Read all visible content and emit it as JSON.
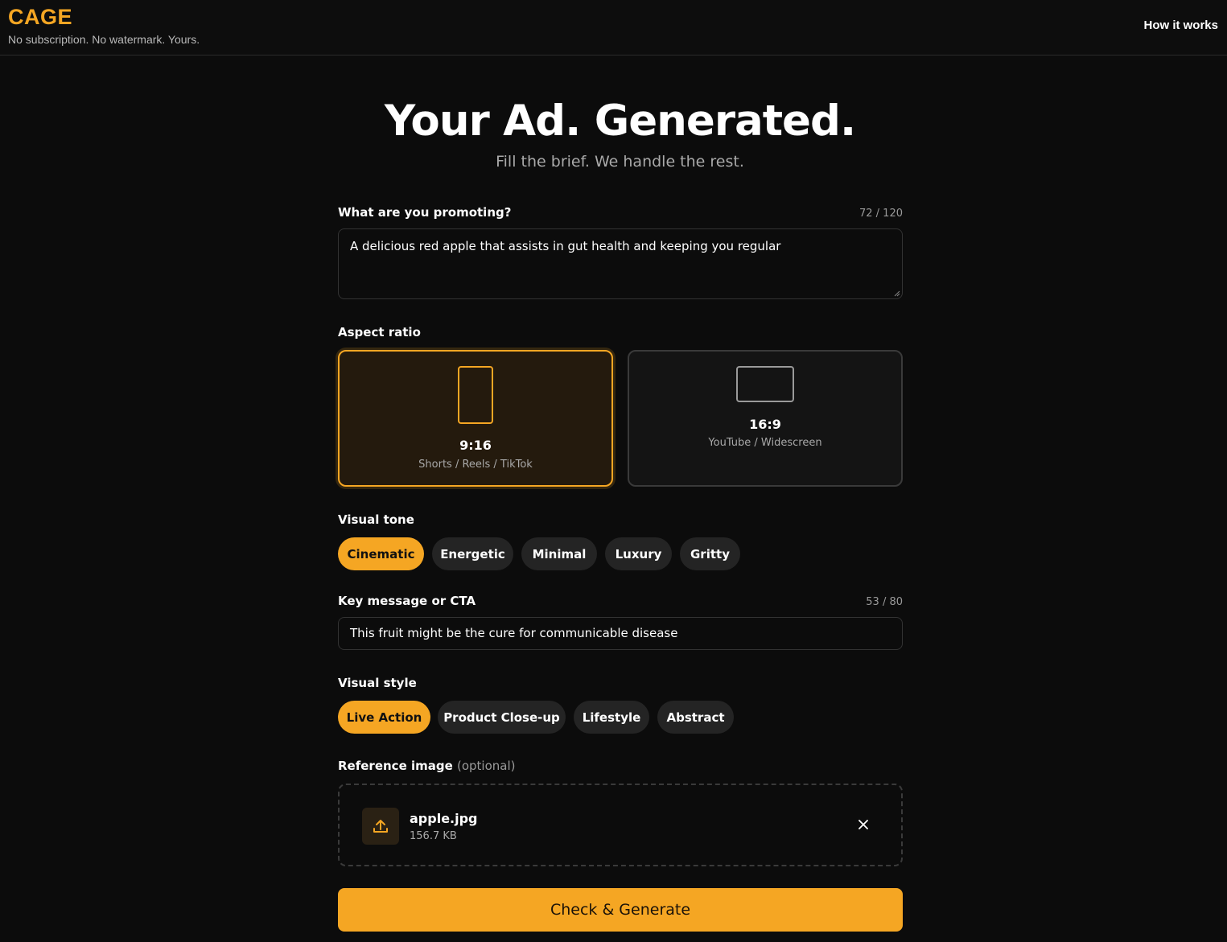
{
  "header": {
    "brand": "CAGE",
    "tagline": "No subscription. No watermark. Yours.",
    "nav_how": "How it works"
  },
  "hero": {
    "title": "Your Ad. Generated.",
    "subtitle": "Fill the brief. We handle the rest."
  },
  "promoting": {
    "label": "What are you promoting?",
    "counter": "72 / 120",
    "value": "A delicious red apple that assists in gut health and keeping you regular"
  },
  "aspect": {
    "label": "Aspect ratio",
    "options": [
      {
        "title": "9:16",
        "subtitle": "Shorts / Reels / TikTok",
        "selected": true
      },
      {
        "title": "16:9",
        "subtitle": "YouTube / Widescreen",
        "selected": false
      }
    ]
  },
  "tone": {
    "label": "Visual tone",
    "options": [
      "Cinematic",
      "Energetic",
      "Minimal",
      "Luxury",
      "Gritty"
    ],
    "selected": "Cinematic"
  },
  "cta_message": {
    "label": "Key message or CTA",
    "counter": "53 / 80",
    "value": "This fruit might be the cure for communicable disease"
  },
  "style": {
    "label": "Visual style",
    "options": [
      "Live Action",
      "Product Close-up",
      "Lifestyle",
      "Abstract"
    ],
    "selected": "Live Action"
  },
  "reference": {
    "label": "Reference image",
    "optional": "(optional)",
    "file_name": "apple.jpg",
    "file_size": "156.7 KB",
    "icon": "upload-icon"
  },
  "submit": {
    "label": "Check & Generate"
  },
  "colors": {
    "accent": "#f5a623",
    "background": "#0c0c0c",
    "chip": "#242424"
  }
}
